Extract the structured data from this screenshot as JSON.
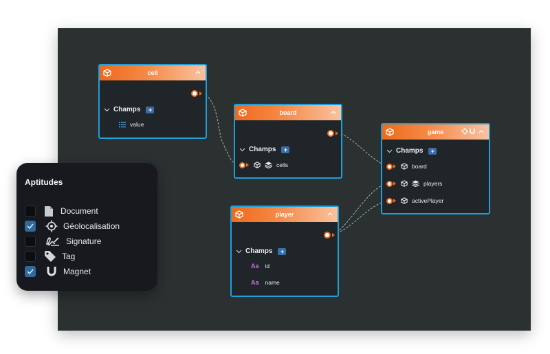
{
  "nodes": {
    "cell": {
      "title": "cell",
      "champs_label": "Champs",
      "add_label": "+",
      "fields": [
        {
          "name": "value",
          "icon": "list-icon"
        }
      ]
    },
    "board": {
      "title": "board",
      "champs_label": "Champs",
      "add_label": "+",
      "fields": [
        {
          "name": "cells",
          "icon": "cube-stack-icon"
        }
      ]
    },
    "game": {
      "title": "game",
      "champs_label": "Champs",
      "add_label": "+",
      "fields": [
        {
          "name": "board",
          "icon": "cube-icon"
        },
        {
          "name": "players",
          "icon": "cube-stack-icon"
        },
        {
          "name": "activePlayer",
          "icon": "cube-icon"
        }
      ]
    },
    "player": {
      "title": "player",
      "champs_label": "Champs",
      "add_label": "+",
      "fields": [
        {
          "name": "id",
          "icon": "text-type-icon",
          "type_glyph": "Aa"
        },
        {
          "name": "name",
          "icon": "text-type-icon",
          "type_glyph": "Aa"
        }
      ]
    }
  },
  "aptitudes": {
    "title": "Aptitudes",
    "items": [
      {
        "label": "Document",
        "checked": false,
        "icon": "document-icon"
      },
      {
        "label": "Géolocalisation",
        "checked": true,
        "icon": "crosshair-icon"
      },
      {
        "label": "Signature",
        "checked": false,
        "icon": "signature-icon"
      },
      {
        "label": "Tag",
        "checked": false,
        "icon": "tag-icon"
      },
      {
        "label": "Magnet",
        "checked": true,
        "icon": "magnet-icon"
      }
    ]
  },
  "colors": {
    "canvas": "#2a3130",
    "node_border": "#1f9fd9",
    "header_orange": "#ee6a1c",
    "port_orange": "#ee6a1c",
    "type_purple": "#c86de0",
    "plus_blue": "#3a6ea5"
  }
}
